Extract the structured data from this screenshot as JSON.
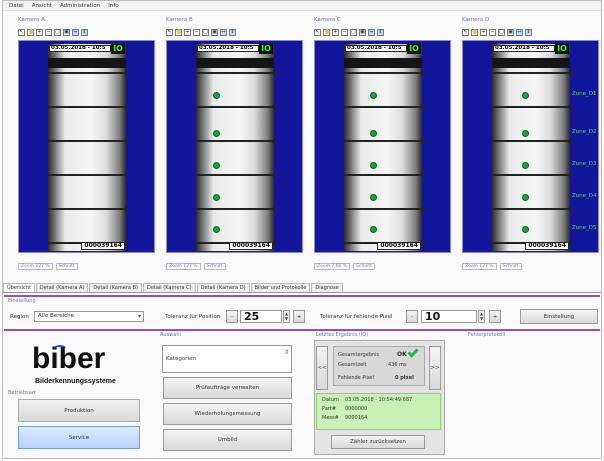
{
  "menu": [
    "Datei",
    "Ansicht",
    "Administration",
    "Info"
  ],
  "cameras": [
    {
      "title": "Kamera A",
      "date": "03.05.2018 - 10:5",
      "io": "IO",
      "counter": "000039164",
      "rois": [],
      "zoom": "Zoom 127 %",
      "status": "Schnitt"
    },
    {
      "title": "Kamera B",
      "date": "03.05.2018 - 10:5",
      "io": "IO",
      "counter": "000039164",
      "rois": [
        "",
        "",
        "",
        "",
        ""
      ],
      "zoom": "Zoom 127 %",
      "status": "Schnitt"
    },
    {
      "title": "Kamera C",
      "date": "03.05.2018 - 10:5",
      "io": "IO",
      "counter": "000039164",
      "rois": [
        "",
        "",
        "",
        "",
        ""
      ],
      "zoom": "Zoom 7,60 %",
      "status": "Schnitt"
    },
    {
      "title": "Kamera D",
      "date": "03.05.2018 - 10:5",
      "io": "IO",
      "counter": "000039164",
      "rois": [
        "Zone_D1",
        "Zone_D2",
        "Zone_D3",
        "Zone_D4",
        "Zone_D5"
      ],
      "zoom": "Zoom 127 %",
      "status": "Schnitt"
    }
  ],
  "toolbar_icons": [
    "cursor-icon",
    "hand-icon",
    "zoom-in-icon",
    "zoom-out-icon",
    "zoom-area-icon",
    "zoom-fit-icon",
    "fit-width-icon",
    "fit-height-icon"
  ],
  "tabs": [
    "Übersicht",
    "Detail (Kamera A)",
    "Detail (Kamera B)",
    "Detail (Kamera C)",
    "Detail (Kamera D)",
    "Bilder und Protokolle",
    "Diagnose"
  ],
  "einstellung": {
    "title": "Einstellung",
    "region_label": "Region",
    "region_value": "Alle Bereiche",
    "tol_pos_label": "Toleranz für Position",
    "tol_pos_value": "25",
    "tol_px_label": "Toleranz für fehlende Pixel",
    "tol_px_value": "10",
    "minus": "-",
    "plus": "+",
    "apply_label": "Einstellung"
  },
  "logo": {
    "text": "biber",
    "sub": "Bilderkennungssysteme",
    "section": "Betriebsart"
  },
  "modes": [
    "Produktion",
    "Service"
  ],
  "auswahl": {
    "title": "Auswahl",
    "select_value": "Kategorien",
    "buttons": [
      "Prüfaufträge verwalten",
      "Wiederholungsmessung",
      "Umbild"
    ]
  },
  "ergebnis": {
    "title": "Letztes Ergebnis (IO)",
    "gesamt_label": "Gesamtergebnis",
    "gesamt_value": "OK",
    "zeit_label": "Gesamtzeit",
    "zeit_value": "436 ms",
    "fehlend_label": "Fehlende Pixel",
    "fehlend_value": "0 pixel",
    "datum_label": "Datum",
    "datum_value": "03.05.2018 - 10:54:49.687",
    "part_label": "Part#",
    "part_value": "0000000",
    "messnr_label": "Mess#",
    "messnr_value": "0000164",
    "prev": "<<",
    "next": ">>",
    "details_button": "Zähler zurücksetzen"
  },
  "protokoll": {
    "title": "Fehlerprotokoll"
  },
  "colors": {
    "accent": "#6b6fd8",
    "camera_bg": "#12169a",
    "ok_green": "#2bb24a",
    "divider": "#9c4fa6"
  }
}
